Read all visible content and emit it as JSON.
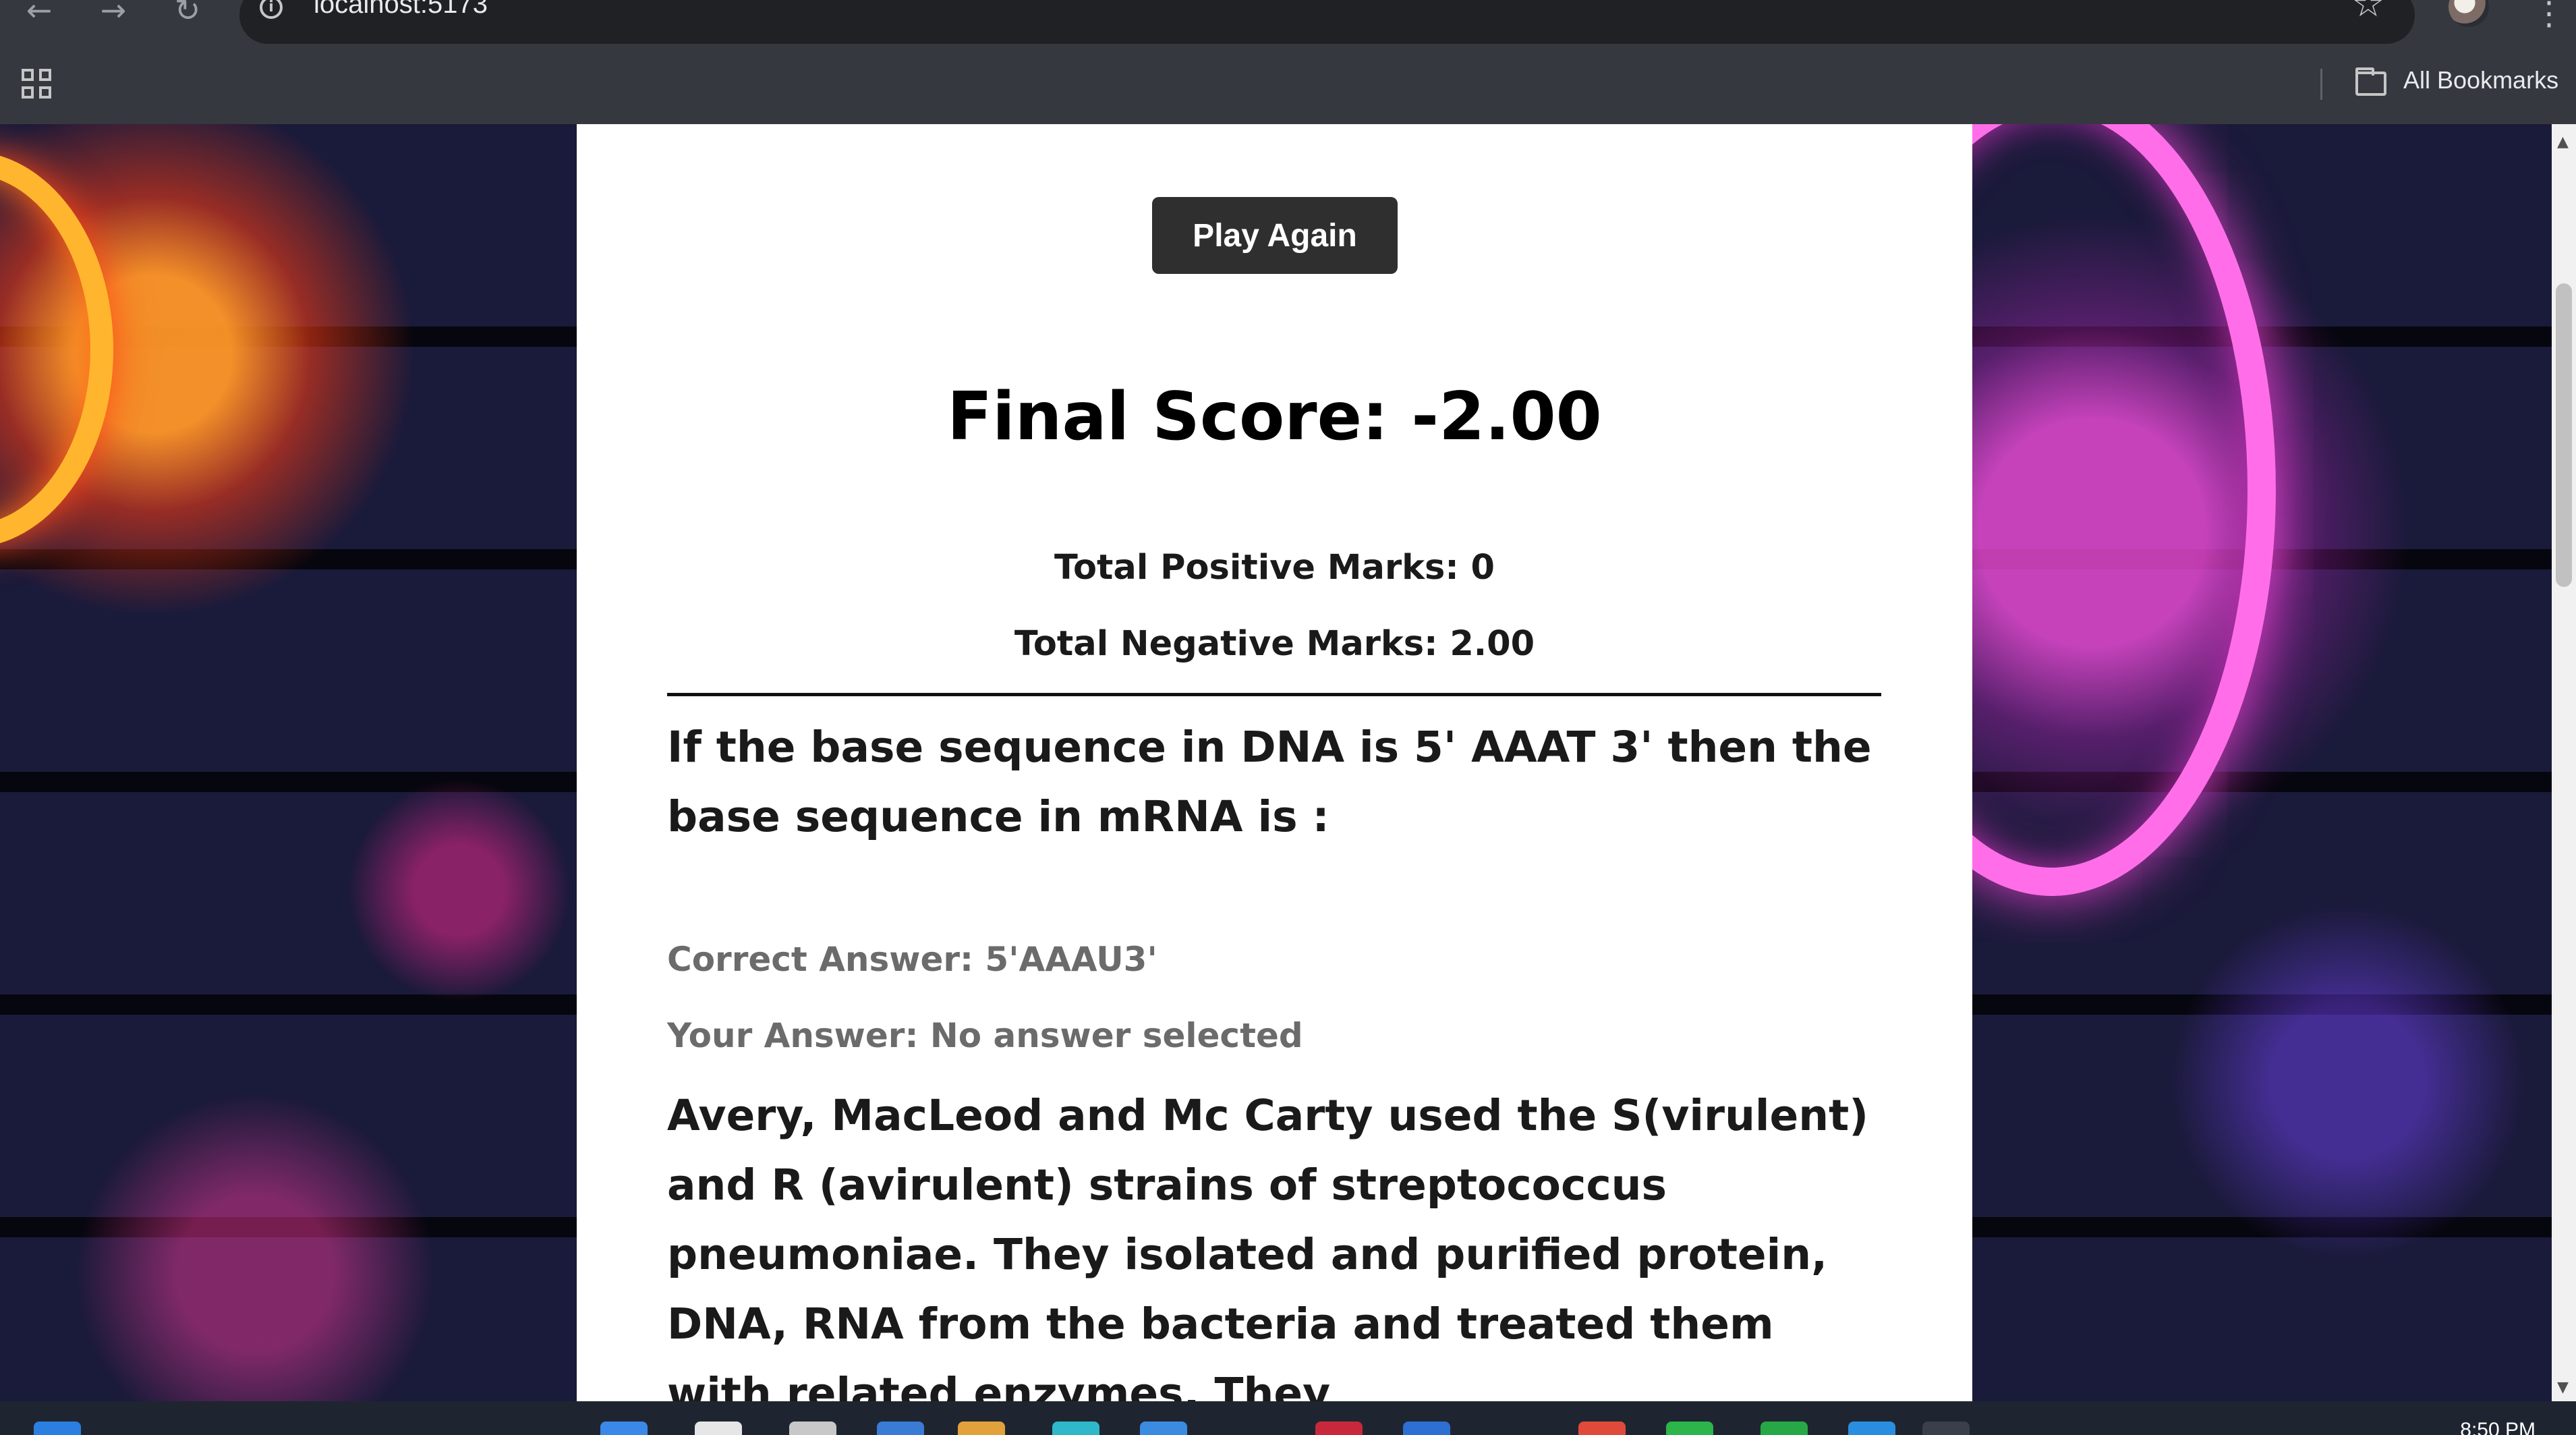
{
  "browser": {
    "url": "localhost:5173",
    "all_bookmarks_label": "All Bookmarks",
    "back_glyph": "←",
    "forward_glyph": "→",
    "reload_glyph": "↻",
    "star_glyph": "☆",
    "menu_glyph": "⋮",
    "info_glyph": "i"
  },
  "results": {
    "play_again_label": "Play Again",
    "final_score": "Final Score: -2.00",
    "total_positive": "Total Positive Marks: 0",
    "total_negative": "Total Negative Marks: 2.00"
  },
  "questions": [
    {
      "text": "If the base sequence in DNA is 5' AAAT 3' then the base sequence in mRNA is :",
      "correct_answer": "Correct Answer: 5'AAAU3'",
      "your_answer": "Your Answer: No answer selected"
    },
    {
      "text": "Avery, MacLeod and Mc Carty used the S(virulent) and R (avirulent) strains of streptococcus pneumoniae. They isolated and purified protein, DNA, RNA from the bacteria and treated them with related enzymes. They"
    }
  ],
  "taskbar": {
    "clock": "8:50 PM"
  },
  "colors": {
    "chrome": "#35393f",
    "omnibox": "#202124",
    "button_bg": "#2f2f2f",
    "answer_text": "#6b6b6b",
    "neon_pink": "#ff6ee8",
    "neon_orange": "#ffb62e"
  },
  "icons": [
    "back-arrow-icon",
    "forward-arrow-icon",
    "reload-icon",
    "info-icon",
    "star-icon",
    "apps-grid-icon",
    "folder-icon",
    "kebab-menu-icon"
  ]
}
